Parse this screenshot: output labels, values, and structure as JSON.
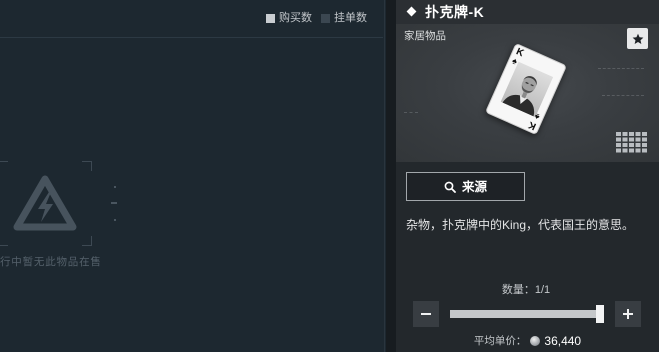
{
  "market": {
    "legend": [
      {
        "label": "购买数",
        "color": "#c9cdd1"
      },
      {
        "label": "挂单数",
        "color": "#3b4751"
      }
    ],
    "empty_icon": "lightning-triangle-icon",
    "empty_message": "行中暂无此物品在售"
  },
  "item": {
    "title_icon": "diamond-icon",
    "title": "扑克牌-K",
    "category": "家居物品",
    "favorite_icon": "star-icon",
    "card": {
      "rank": "K",
      "suit": "♠"
    },
    "size_icon": "grid-icon",
    "source_button": {
      "icon": "search-icon",
      "label": "来源"
    },
    "description": "杂物，扑克牌中的King，代表国王的意思。"
  },
  "purchase": {
    "quantity_label": "数量：",
    "quantity_value": "1/1",
    "slider_level": 1,
    "minus_icon": "minus-icon",
    "plus_icon": "plus-icon",
    "price_label": "平均单价：",
    "currency_icon": "coin-icon",
    "price_value": "36,440"
  },
  "colors": {
    "market_bg": "#1d2830",
    "divider_bg": "#171c20",
    "panel_bg": "#23282c",
    "header_bg": "#2b2f33",
    "image_bg": "#3a3e42",
    "text": "#e9eaeb"
  }
}
